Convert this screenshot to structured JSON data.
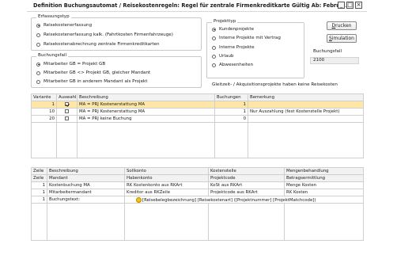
{
  "window": {
    "title": "Definition Buchungsautomat / Reisekostenregeln: Regel für zentrale Firmenkreditkarte Gültig Ab: Februa...",
    "minimize": "_",
    "maximize": "□",
    "close": "×"
  },
  "erfassungstyp": {
    "label": "Erfassungstyp",
    "options": [
      {
        "label": "Reisekostenerfassung",
        "selected": true
      },
      {
        "label": "Reisekostenerfassung kalk. (Fahrtkosten Firmenfahrzeuge)",
        "selected": false
      },
      {
        "label": "Reisekostenabrechnung zentrale Firmenkreditkarten",
        "selected": false
      }
    ]
  },
  "buchungsfall": {
    "label": "Buchungsfall",
    "options": [
      {
        "label": "Mitarbeiter GB = Projekt GB",
        "selected": true
      },
      {
        "label": "Mitarbeiter GB <> Projekt GB, gleicher Mandant",
        "selected": false
      },
      {
        "label": "Mitarbeiter GB in anderem Mandant als Projekt",
        "selected": false
      }
    ]
  },
  "projekttyp": {
    "label": "Projekttyp",
    "options": [
      {
        "label": "Kundenprojekte",
        "selected": true
      },
      {
        "label": "Interne Projekte mit Vertrag",
        "selected": false
      },
      {
        "label": "Interne Projekte",
        "selected": false
      },
      {
        "label": "Urlaub",
        "selected": false
      },
      {
        "label": "Abwesenheiten",
        "selected": false
      }
    ]
  },
  "buttons": {
    "drucken_u": "D",
    "drucken_rest": "rucken",
    "simulation_u": "S",
    "simulation_rest": "imulation"
  },
  "buchungsfall_field": {
    "label": "Buchungsfall",
    "value": "2100"
  },
  "hint_text": "Gleitzeit- / Akquisitionsprojekte haben keine Reisekosten",
  "variants_table": {
    "headers": [
      "Variante",
      "Auswahl",
      "Beschreibung",
      "Buchungen",
      "Bemerkung"
    ],
    "rows": [
      {
        "variante": "1",
        "auswahl": true,
        "beschreibung": "MA = PRJ Kostenerstattung MA",
        "buchungen": "1",
        "bemerkung": "",
        "selected": true
      },
      {
        "variante": "10",
        "auswahl": false,
        "beschreibung": "MA = PRJ Kostenerstattung MA",
        "buchungen": "1",
        "bemerkung": "Nur Auszahlung (fest Kostenstelle Projekt)",
        "selected": false
      },
      {
        "variante": "20",
        "auswahl": false,
        "beschreibung": "MA = PRJ keine Buchung",
        "buchungen": "0",
        "bemerkung": "",
        "selected": false
      }
    ]
  },
  "booking_table": {
    "headers1": [
      "Zeile",
      "Beschreibung",
      "Sollkonto",
      "Kostenstelle",
      "Mengenbehandlung"
    ],
    "headers2": [
      "Zeile",
      "Mandant",
      "Habenkonto",
      "Projektcode",
      "Betragsermittlung"
    ],
    "rows": [
      [
        "1",
        "Kostenbuchung MA",
        "RK Kostenkonto aus RKArt",
        "KoSt aus RKArt",
        "Menge Kosten"
      ],
      [
        "1",
        "Mitarbeitermandant",
        "Kreditor aus RKZeile",
        "Projektcode aus RKArt",
        "RK Kosten"
      ]
    ],
    "buchungstext_row": {
      "zeile": "1",
      "label": "Buchungstext:",
      "value": "[Reisebelegbezeichnung] [Reisekostenart] ([Projektnummer] [ProjektMatchcode])"
    }
  }
}
